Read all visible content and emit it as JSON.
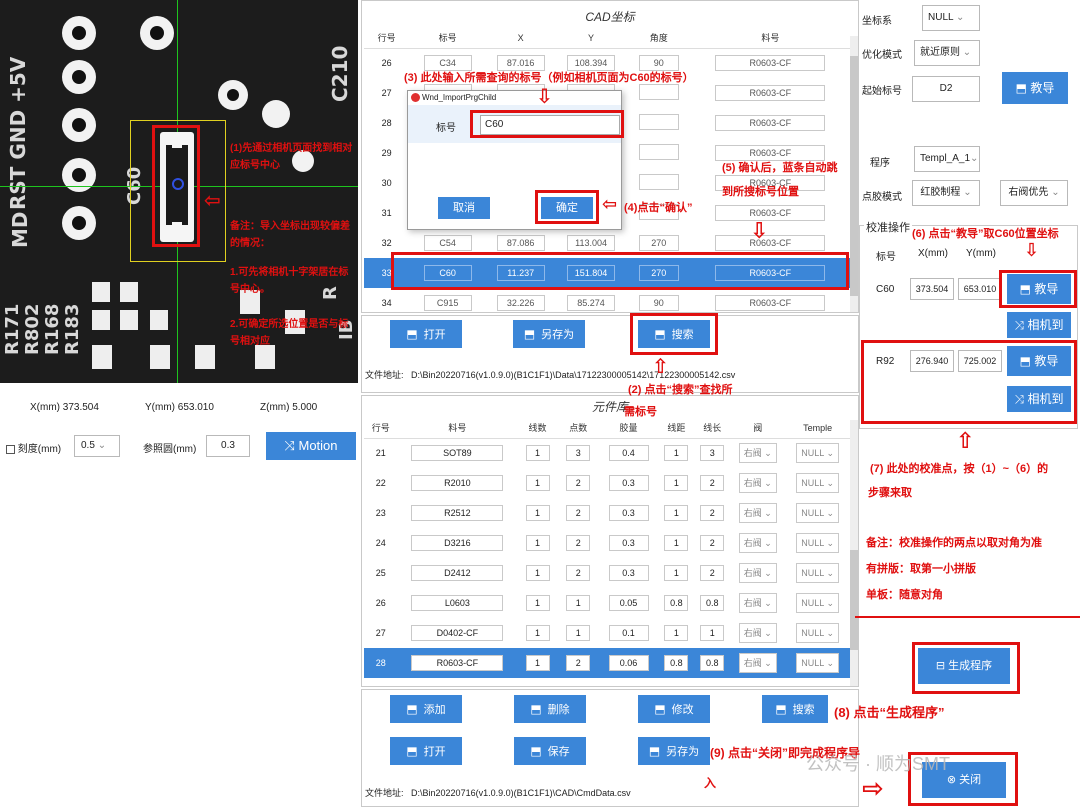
{
  "camera": {
    "silk": {
      "top": "RST GND +5V",
      "md": "MD",
      "c60": "C60",
      "c210": "C210",
      "r171": "R171",
      "r802": "R802",
      "r168": "R168",
      "r183": "R183",
      "ra": "R",
      "ib": "IB"
    },
    "annotation_1": "(1)先通过相机页面找到相对应标号中心",
    "annotation_note": "备注：导入坐标出现较偏差的情况：",
    "annotation_note_1": "1.可先将相机十字架居在标号中心。",
    "annotation_note_2": "2.可确定所选位置是否与标号相对应"
  },
  "readout": {
    "x_label": "X(mm)",
    "x_value": "373.504",
    "y_label": "Y(mm)",
    "y_value": "653.010",
    "z_label": "Z(mm)",
    "z_value": "5.000",
    "scale_label": "刻度(mm)",
    "scale_value": "0.5",
    "ref_label": "参照圆(mm)",
    "ref_value": "0.3",
    "motion_label": "Motion"
  },
  "cad": {
    "title": "CAD坐标",
    "columns": [
      "行号",
      "标号",
      "X",
      "Y",
      "角度",
      "料号"
    ],
    "rows": [
      [
        "26",
        "C34",
        "87.016",
        "108.394",
        "90",
        "R0603-CF"
      ],
      [
        "27",
        "",
        "",
        "",
        "",
        "R0603-CF"
      ],
      [
        "28",
        "",
        "",
        "",
        "",
        "R0603-CF"
      ],
      [
        "29",
        "",
        "",
        "",
        "",
        "R0603-CF"
      ],
      [
        "30",
        "",
        "",
        "",
        "",
        "R0603-CF"
      ],
      [
        "31",
        "",
        "",
        "",
        "",
        "R0603-CF"
      ],
      [
        "32",
        "C54",
        "87.086",
        "113.004",
        "270",
        "R0603-CF"
      ],
      [
        "33",
        "C60",
        "11.237",
        "151.804",
        "270",
        "R0603-CF"
      ],
      [
        "34",
        "C915",
        "32.226",
        "85.274",
        "90",
        "R0603-CF"
      ]
    ],
    "btn_open": "打开",
    "btn_saveas": "另存为",
    "btn_search": "搜索",
    "file_label": "文件地址:",
    "file_path": "D:\\Bin20220716(v1.0.9.0)(B1C1F1)\\Data\\17122300005142\\17122300005142.csv"
  },
  "dialog": {
    "title": "Wnd_ImportPrgChild",
    "field_label": "标号",
    "field_value": "C60",
    "cancel": "取消",
    "ok": "确定"
  },
  "lib": {
    "title": "元件库",
    "columns": [
      "行号",
      "料号",
      "线数",
      "点数",
      "胶量",
      "线距",
      "线长",
      "阀",
      "Temple"
    ],
    "rows": [
      [
        "21",
        "SOT89",
        "1",
        "3",
        "0.4",
        "1",
        "3",
        "右阀",
        "NULL"
      ],
      [
        "22",
        "R2010",
        "1",
        "2",
        "0.3",
        "1",
        "2",
        "右阀",
        "NULL"
      ],
      [
        "23",
        "R2512",
        "1",
        "2",
        "0.3",
        "1",
        "2",
        "右阀",
        "NULL"
      ],
      [
        "24",
        "D3216",
        "1",
        "2",
        "0.3",
        "1",
        "2",
        "右阀",
        "NULL"
      ],
      [
        "25",
        "D2412",
        "1",
        "2",
        "0.3",
        "1",
        "2",
        "右阀",
        "NULL"
      ],
      [
        "26",
        "L0603",
        "1",
        "1",
        "0.05",
        "0.8",
        "0.8",
        "右阀",
        "NULL"
      ],
      [
        "27",
        "D0402-CF",
        "1",
        "1",
        "0.1",
        "1",
        "1",
        "右阀",
        "NULL"
      ],
      [
        "28",
        "R0603-CF",
        "1",
        "2",
        "0.06",
        "0.8",
        "0.8",
        "右阀",
        "NULL"
      ]
    ],
    "btn_add": "添加",
    "btn_delete": "删除",
    "btn_modify": "修改",
    "btn_search": "搜索",
    "btn_open": "打开",
    "btn_save": "保存",
    "btn_saveas": "另存为",
    "file_label": "文件地址:",
    "file_path": "D:\\Bin20220716(v1.0.9.0)(B1C1F1)\\CAD\\CmdData.csv"
  },
  "right": {
    "coord_label": "坐标系",
    "coord_value": "NULL",
    "opt_label": "优化模式",
    "opt_value": "就近原则",
    "start_label": "起始标号",
    "start_value": "D2",
    "teach_label": "教导",
    "program_label": "程序",
    "program_value": "Templ_A_1",
    "glue_label": "点胶模式",
    "glue_value": "红胶制程",
    "valve_value": "右阀优先",
    "calib_title": "校准操作",
    "col_mark": "标号",
    "col_x": "X(mm)",
    "col_y": "Y(mm)",
    "p1_mark": "C60",
    "p1_x": "373.504",
    "p1_y": "653.010",
    "p2_mark": "R92",
    "p2_x": "276.940",
    "p2_y": "725.002",
    "camera_to": "相机到",
    "generate": "生成程序",
    "close": "关闭"
  },
  "notes": {
    "n3": "(3) 此处输入所需查询的标号（例如相机页面为C60的标号）",
    "n2a": "(2) 点击“搜索”查找所",
    "n2b": "需标号",
    "n4": "(4)点击“确认”",
    "n5a": "(5) 确认后，蓝条自动跳",
    "n5b": "到所搜标号位置",
    "n6": "(6) 点击“教导”取C60位置坐标",
    "n7a": "(7) 此处的校准点，按（1）~（6）的",
    "n7b": "步骤来取",
    "n8": "(8) 点击“生成程序”",
    "n9a": "(9) 点击“关闭”即完成程序导",
    "n9b": "入",
    "remark1": "备注：校准操作的两点以取对角为准",
    "remark2": "有拼版：取第一小拼版",
    "remark3": "单板：随意对角"
  },
  "watermark": "公众号 · 顺为SMT"
}
